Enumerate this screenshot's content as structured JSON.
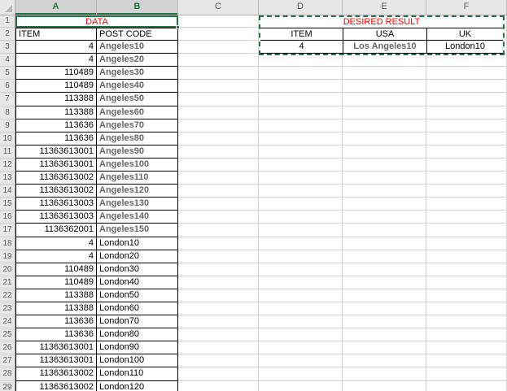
{
  "colors": {
    "accent-green": "#217346",
    "title-red": "#FF0000",
    "muted-gray": "#666666"
  },
  "sheet": {
    "columns": [
      {
        "label": "A",
        "sel": "selected"
      },
      {
        "label": "B",
        "sel": "selected"
      },
      {
        "label": "C"
      },
      {
        "label": "D"
      },
      {
        "label": "E"
      },
      {
        "label": "F"
      }
    ],
    "row1_number": "1"
  },
  "data_table": {
    "title": "DATA",
    "rows": [
      {
        "n": "2",
        "item": "ITEM",
        "post": "POST CODE",
        "cls": "hdr"
      },
      {
        "n": "3",
        "item": "4",
        "post": "Angeles10",
        "mut": "muted"
      },
      {
        "n": "4",
        "item": "4",
        "post": "Angeles20",
        "mut": "muted"
      },
      {
        "n": "5",
        "item": "110489",
        "post": "Angeles30",
        "mut": "muted"
      },
      {
        "n": "6",
        "item": "110489",
        "post": "Angeles40",
        "mut": "muted"
      },
      {
        "n": "7",
        "item": "113388",
        "post": "Angeles50",
        "mut": "muted"
      },
      {
        "n": "8",
        "item": "113388",
        "post": "Angeles60",
        "mut": "muted"
      },
      {
        "n": "9",
        "item": "113636",
        "post": "Angeles70",
        "mut": "muted"
      },
      {
        "n": "10",
        "item": "113636",
        "post": "Angeles80",
        "mut": "muted"
      },
      {
        "n": "11",
        "item": "11363613001",
        "post": "Angeles90",
        "mut": "muted"
      },
      {
        "n": "12",
        "item": "11363613001",
        "post": "Angeles100",
        "mut": "muted"
      },
      {
        "n": "13",
        "item": "11363613002",
        "post": "Angeles110",
        "mut": "muted"
      },
      {
        "n": "14",
        "item": "11363613002",
        "post": "Angeles120",
        "mut": "muted"
      },
      {
        "n": "15",
        "item": "11363613003",
        "post": "Angeles130",
        "mut": "muted"
      },
      {
        "n": "16",
        "item": "11363613003",
        "post": "Angeles140",
        "mut": "muted"
      },
      {
        "n": "17",
        "item": "1136362001",
        "post": "Angeles150",
        "mut": "muted"
      },
      {
        "n": "18",
        "item": "4",
        "post": "London10"
      },
      {
        "n": "19",
        "item": "4",
        "post": "London20"
      },
      {
        "n": "20",
        "item": "110489",
        "post": "London30"
      },
      {
        "n": "21",
        "item": "110489",
        "post": "London40"
      },
      {
        "n": "22",
        "item": "113388",
        "post": "London50"
      },
      {
        "n": "23",
        "item": "113388",
        "post": "London60"
      },
      {
        "n": "24",
        "item": "113636",
        "post": "London70"
      },
      {
        "n": "25",
        "item": "113636",
        "post": "London80"
      },
      {
        "n": "26",
        "item": "11363613001",
        "post": "London90"
      },
      {
        "n": "27",
        "item": "11363613001",
        "post": "London100"
      },
      {
        "n": "28",
        "item": "11363613002",
        "post": "London110"
      },
      {
        "n": "29",
        "item": "11363613002",
        "post": "London120"
      }
    ]
  },
  "result_table": {
    "title": "DESIRED RESULT",
    "rows": [
      {
        "d": "ITEM",
        "e": "USA",
        "f": "UK"
      },
      {
        "d": "4",
        "e": "Los Angeles10",
        "f": "London10",
        "ecls": "muted"
      }
    ]
  }
}
